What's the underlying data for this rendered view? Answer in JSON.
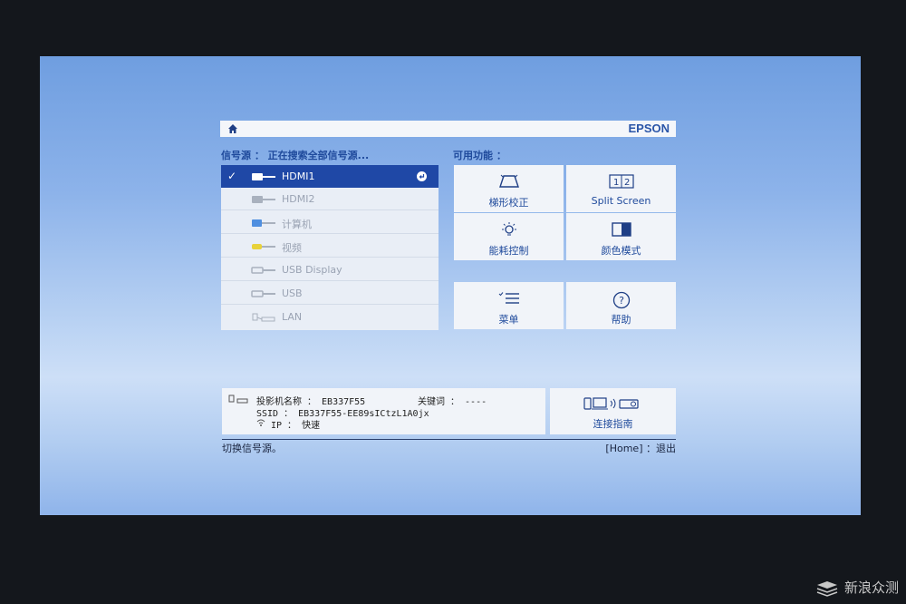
{
  "brand": "EPSON",
  "headers": {
    "source": "信号源 ： 正在搜索全部信号源...",
    "features": "可用功能 ："
  },
  "sources": [
    {
      "label": "HDMI1",
      "icon": "hdmi-icon",
      "selected": true
    },
    {
      "label": "HDMI2",
      "icon": "hdmi-icon",
      "selected": false
    },
    {
      "label": "计算机",
      "icon": "vga-icon",
      "selected": false
    },
    {
      "label": "视频",
      "icon": "video-icon",
      "selected": false
    },
    {
      "label": "USB Display",
      "icon": "usb-icon",
      "selected": false
    },
    {
      "label": "USB",
      "icon": "usb-icon",
      "selected": false
    },
    {
      "label": "LAN",
      "icon": "lan-icon",
      "selected": false
    }
  ],
  "features": {
    "keystone": "梯形校正",
    "split_screen": "Split Screen",
    "power": "能耗控制",
    "color_mode": "颜色模式",
    "menu": "菜单",
    "help": "帮助"
  },
  "info": {
    "projector_name": "投影机名称 ： EB337F55",
    "keyword": "关键词 ： ----",
    "ssid": "SSID ： EB337F55-EE89sICtzL1A0jx",
    "ip": "IP ： 快速"
  },
  "connection_guide": "连接指南",
  "footer": {
    "left": "切换信号源。",
    "right": "[Home] ：退出"
  },
  "watermark": "新浪众测",
  "colors": {
    "accent": "#1f48a6",
    "title_text": "#1f4a9c",
    "screen_blue": "#8db3ea"
  }
}
